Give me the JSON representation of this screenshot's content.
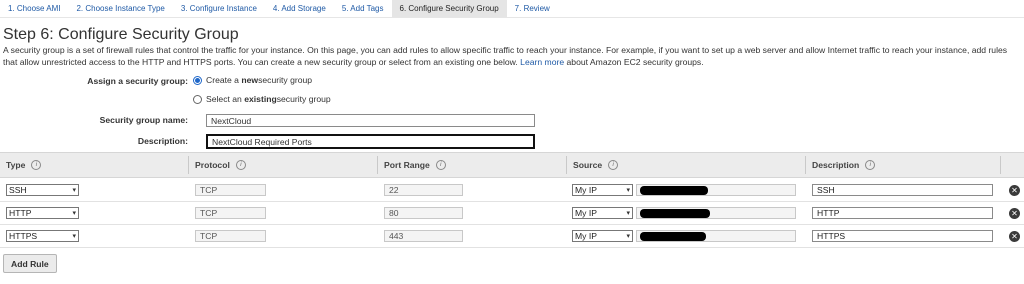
{
  "tabs": [
    {
      "label": "1. Choose AMI"
    },
    {
      "label": "2. Choose Instance Type"
    },
    {
      "label": "3. Configure Instance"
    },
    {
      "label": "4. Add Storage"
    },
    {
      "label": "5. Add Tags"
    },
    {
      "label": "6. Configure Security Group",
      "active": true
    },
    {
      "label": "7. Review"
    }
  ],
  "page": {
    "title": "Step 6: Configure Security Group",
    "intro": "A security group is a set of firewall rules that control the traffic for your instance. On this page, you can add rules to allow specific traffic to reach your instance. For example, if you want to set up a web server and allow Internet traffic to reach your instance, add rules that allow unrestricted access to the HTTP and HTTPS ports. You can create a new security group or select from an existing one below.",
    "learn_more": "Learn more",
    "intro_tail": "about Amazon EC2 security groups."
  },
  "form": {
    "assign_label": "Assign a security group:",
    "radio_new_prefix": "Create a ",
    "radio_new_bold": "new",
    "radio_new_suffix": " security group",
    "radio_existing_prefix": "Select an ",
    "radio_existing_bold": "existing",
    "radio_existing_suffix": " security group",
    "group_name_label": "Security group name:",
    "group_name_value": "NextCloud",
    "description_label": "Description:",
    "description_value": "NextCloud Required Ports"
  },
  "table": {
    "headers": {
      "type": "Type",
      "protocol": "Protocol",
      "port_range": "Port Range",
      "source": "Source",
      "description": "Description"
    },
    "info_glyph": "i",
    "rows": [
      {
        "type": "SSH",
        "protocol": "TCP",
        "port": "22",
        "source": "My IP",
        "description": "SSH"
      },
      {
        "type": "HTTP",
        "protocol": "TCP",
        "port": "80",
        "source": "My IP",
        "description": "HTTP"
      },
      {
        "type": "HTTPS",
        "protocol": "TCP",
        "port": "443",
        "source": "My IP",
        "description": "HTTPS"
      }
    ]
  },
  "buttons": {
    "add_rule": "Add Rule"
  },
  "icons": {
    "caret": "▾",
    "remove": "✕"
  }
}
